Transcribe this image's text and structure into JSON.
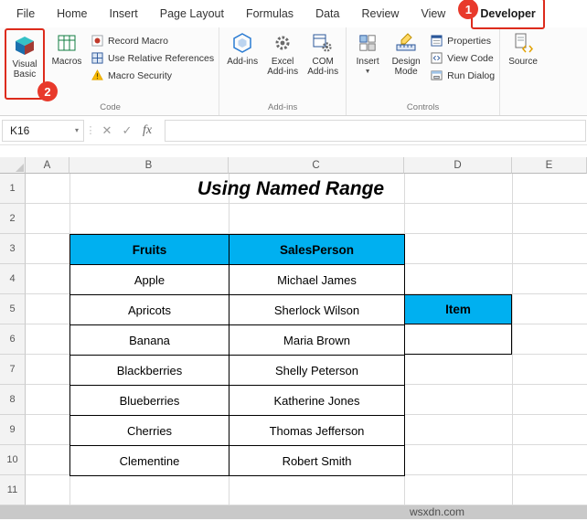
{
  "colors": {
    "table_header_fill": "#00B0F0",
    "annotation_red": "#DD2B1C",
    "grid_line": "#DADADA",
    "header_bg": "#F3F3F3"
  },
  "ribbon": {
    "tabs": [
      "File",
      "Home",
      "Insert",
      "Page Layout",
      "Formulas",
      "Data",
      "Review",
      "View",
      "Developer"
    ],
    "active_tab": "Developer",
    "code_group": {
      "label": "Code",
      "visual_basic": "Visual Basic",
      "macros": "Macros",
      "record_macro": "Record Macro",
      "use_relative_references": "Use Relative References",
      "macro_security": "Macro Security"
    },
    "addins_group": {
      "label": "Add-ins",
      "add_ins": "Add-ins",
      "excel_add_ins": "Excel Add-ins",
      "com_add_ins": "COM Add-ins"
    },
    "controls_group": {
      "label": "Controls",
      "insert": "Insert",
      "design_mode": "Design Mode",
      "properties": "Properties",
      "view_code": "View Code",
      "run_dialog": "Run Dialog"
    },
    "xml_group": {
      "source": "Source"
    }
  },
  "annotations": {
    "step_1": "1",
    "step_2": "2"
  },
  "formula_bar": {
    "name_box": "K16",
    "chevron": "▾",
    "divider_glyph": "⋮",
    "cancel_glyph": "✕",
    "enter_glyph": "✓",
    "fx_glyph": "fx",
    "value": ""
  },
  "sheet": {
    "title": "Using Named Range",
    "column_headers": [
      "A",
      "B",
      "C",
      "D",
      "E"
    ],
    "row_headers": [
      "1",
      "2",
      "3",
      "4",
      "5",
      "6",
      "7",
      "8",
      "9",
      "10",
      "11"
    ],
    "table": {
      "headers": [
        "Fruits",
        "SalesPerson"
      ],
      "rows": [
        [
          "Apple",
          "Michael James"
        ],
        [
          "Apricots",
          "Sherlock Wilson"
        ],
        [
          "Banana",
          "Maria Brown"
        ],
        [
          "Blackberries",
          "Shelly Peterson"
        ],
        [
          "Blueberries",
          "Katherine Jones"
        ],
        [
          "Cherries",
          "Thomas Jefferson"
        ],
        [
          "Clementine",
          "Robert Smith"
        ]
      ]
    },
    "item_header": "Item",
    "item_value": ""
  },
  "watermark": {
    "text": "wsxdn.com"
  },
  "icons": {
    "visual_basic": "vb-cube-icon",
    "macros": "macro-table-icon",
    "record_macro": "record-dot-icon",
    "use_relative_references": "relative-grid-icon",
    "macro_security": "warning-triangle-icon",
    "add_ins": "hexagon-icon",
    "excel_add_ins": "gear-icon",
    "com_add_ins": "window-gear-icon",
    "insert_controls": "toolbox-icon",
    "design_mode": "ruler-pencil-icon",
    "properties": "properties-window-icon",
    "view_code": "code-window-icon",
    "run_dialog": "dialog-window-icon",
    "source": "xml-document-icon",
    "name_box_dropdown": "chevron-down-icon",
    "cancel": "x-icon",
    "enter": "check-icon",
    "insert_function": "fx-icon"
  }
}
